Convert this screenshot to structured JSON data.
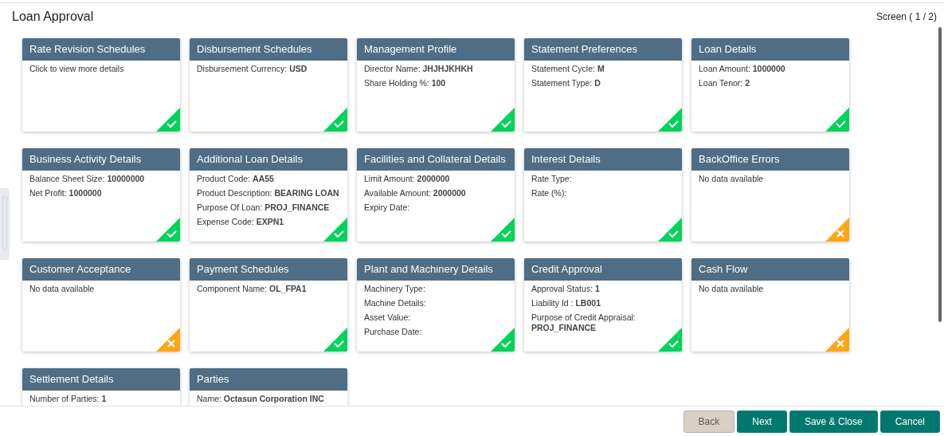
{
  "title": "Loan Approval",
  "screen_indicator": "Screen ( 1 / 2)",
  "cards": [
    {
      "title": "Rate Revision Schedules",
      "complete": true,
      "lines": [
        {
          "label": "Click to view more details"
        }
      ]
    },
    {
      "title": "Disbursement Schedules",
      "complete": true,
      "lines": [
        {
          "label": "Disbursement Currency:",
          "value": "USD"
        }
      ]
    },
    {
      "title": "Management Profile",
      "complete": true,
      "lines": [
        {
          "label": "Director Name:",
          "value": "JHJHJKHKH"
        },
        {
          "label": "Share Holding %:",
          "value": "100"
        }
      ]
    },
    {
      "title": "Statement Preferences",
      "complete": true,
      "lines": [
        {
          "label": "Statement Cycle:",
          "value": "M"
        },
        {
          "label": "Statement Type:",
          "value": "D"
        }
      ]
    },
    {
      "title": "Loan Details",
      "complete": true,
      "lines": [
        {
          "label": "Loan Amount:",
          "value": "1000000"
        },
        {
          "label": "Loan Tenor:",
          "value": "2"
        }
      ]
    },
    {
      "title": "Business Activity Details",
      "complete": true,
      "lines": [
        {
          "label": "Balance Sheet Size:",
          "value": "10000000"
        },
        {
          "label": "Net Profit:",
          "value": "1000000"
        }
      ]
    },
    {
      "title": "Additional Loan Details",
      "complete": true,
      "lines": [
        {
          "label": "Product Code:",
          "value": "AA55"
        },
        {
          "label": "Product Description:",
          "value": "BEARING LOAN"
        },
        {
          "label": "Purpose Of Loan:",
          "value": "PROJ_FINANCE"
        },
        {
          "label": "Expense Code:",
          "value": "EXPN1"
        }
      ]
    },
    {
      "title": "Facilities and Collateral Details",
      "complete": true,
      "lines": [
        {
          "label": "Limit Amount:",
          "value": "2000000"
        },
        {
          "label": "Available Amount:",
          "value": "2000000"
        },
        {
          "label": "Expiry Date:"
        }
      ]
    },
    {
      "title": "Interest Details",
      "complete": true,
      "lines": [
        {
          "label": "Rate Type:"
        },
        {
          "label": "Rate (%):"
        }
      ]
    },
    {
      "title": "BackOffice Errors",
      "complete": false,
      "lines": [
        {
          "label": "No data available"
        }
      ]
    },
    {
      "title": "Customer Acceptance",
      "complete": false,
      "lines": [
        {
          "label": "No data available"
        }
      ]
    },
    {
      "title": "Payment Schedules",
      "complete": true,
      "lines": [
        {
          "label": "Component Name:",
          "value": "OL_FPA1"
        }
      ]
    },
    {
      "title": "Plant and Machinery Details",
      "complete": true,
      "lines": [
        {
          "label": "Machinery Type:"
        },
        {
          "label": "Machine Details:"
        },
        {
          "label": "Asset Value:"
        },
        {
          "label": "Purchase Date:"
        }
      ]
    },
    {
      "title": "Credit Approval",
      "complete": true,
      "lines": [
        {
          "label": "Approval Status:",
          "value": "1"
        },
        {
          "label": "Liability Id :",
          "value": "LB001"
        },
        {
          "label": "Purpose of Credit Appraisal:",
          "value": "PROJ_FINANCE"
        }
      ]
    },
    {
      "title": "Cash Flow",
      "complete": false,
      "lines": [
        {
          "label": "No data available"
        }
      ]
    },
    {
      "title": "Settlement Details",
      "lines": [
        {
          "label": "Number of Parties:",
          "value": "1"
        }
      ]
    },
    {
      "title": "Parties",
      "lines": [
        {
          "label": "Name:",
          "value": "Octasun Corporation INC"
        }
      ]
    }
  ],
  "buttons": [
    {
      "label": "Back",
      "disabled": true
    },
    {
      "label": "Next",
      "disabled": false
    },
    {
      "label": "Save & Close",
      "disabled": false
    },
    {
      "label": "Cancel",
      "disabled": false
    }
  ]
}
